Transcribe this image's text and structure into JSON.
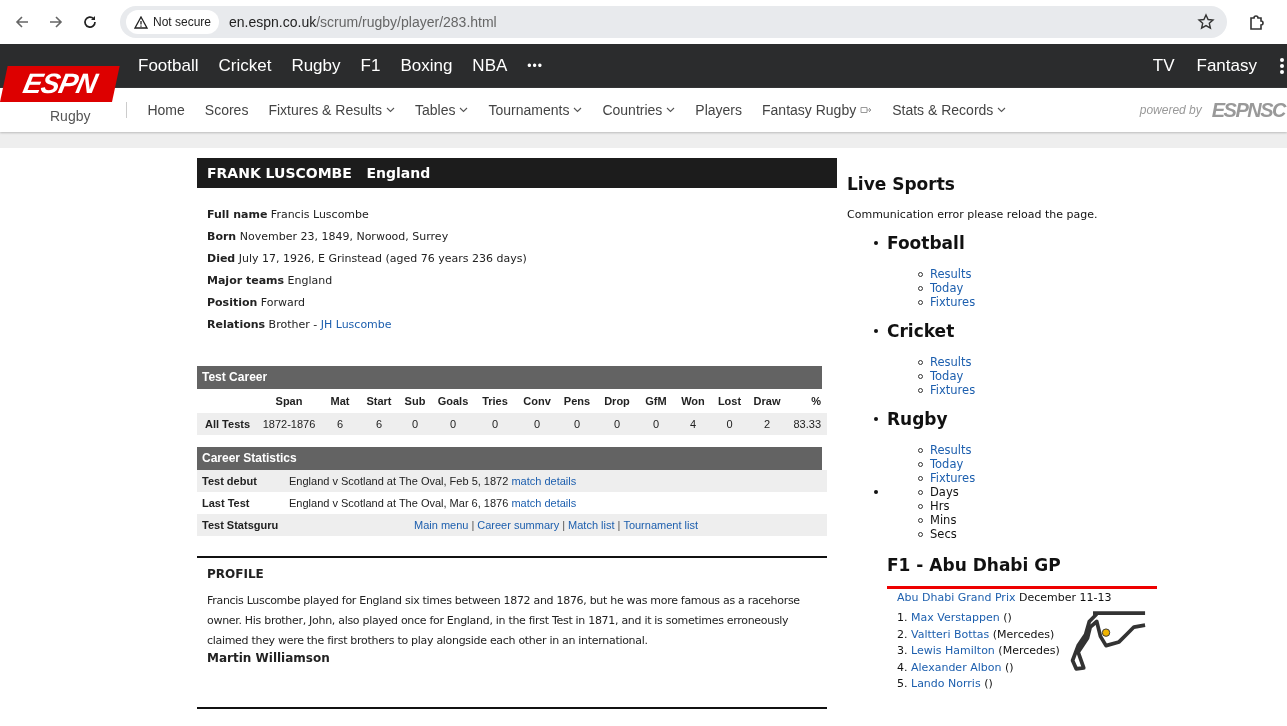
{
  "browser": {
    "security": "Not secure",
    "url_host": "en.espn.co.uk",
    "url_path": "/scrum/rugby/player/283.html"
  },
  "espn_nav": {
    "logo": "ESPN",
    "sports": [
      "Football",
      "Cricket",
      "Rugby",
      "F1",
      "Boxing",
      "NBA"
    ],
    "more": "•••",
    "right": [
      "TV",
      "Fantasy"
    ]
  },
  "sub_nav": {
    "section": "Rugby",
    "items": [
      {
        "label": "Home",
        "dropdown": false,
        "external": false
      },
      {
        "label": "Scores",
        "dropdown": false,
        "external": false
      },
      {
        "label": "Fixtures & Results",
        "dropdown": true,
        "external": false
      },
      {
        "label": "Tables",
        "dropdown": true,
        "external": false
      },
      {
        "label": "Tournaments",
        "dropdown": true,
        "external": false
      },
      {
        "label": "Countries",
        "dropdown": true,
        "external": false
      },
      {
        "label": "Players",
        "dropdown": false,
        "external": false
      },
      {
        "label": "Fantasy Rugby",
        "dropdown": false,
        "external": true
      },
      {
        "label": "Stats & Records",
        "dropdown": true,
        "external": false
      }
    ],
    "powered_by": "powered by",
    "brand": "ESPNSC"
  },
  "player": {
    "name": "FRANK LUSCOMBE",
    "country": "England",
    "info": [
      {
        "label": "Full name",
        "value": "Francis Luscombe"
      },
      {
        "label": "Born",
        "value": "November 23, 1849, Norwood, Surrey"
      },
      {
        "label": "Died",
        "value": "July 17, 1926, E Grinstead (aged 76 years 236 days)"
      },
      {
        "label": "Major teams",
        "value": "England"
      },
      {
        "label": "Position",
        "value": "Forward"
      },
      {
        "label": "Relations",
        "value": "Brother - ",
        "link": "JH Luscombe"
      }
    ]
  },
  "test_career": {
    "title": "Test Career",
    "columns": [
      "Span",
      "Mat",
      "Start",
      "Sub",
      "Goals",
      "Tries",
      "Conv",
      "Pens",
      "Drop",
      "GfM",
      "Won",
      "Lost",
      "Draw",
      "%"
    ],
    "rows": [
      {
        "label": "All Tests",
        "cells": [
          "1872-1876",
          "6",
          "6",
          "0",
          "0",
          "0",
          "0",
          "0",
          "0",
          "0",
          "4",
          "0",
          "2",
          "83.33"
        ]
      }
    ]
  },
  "career_statistics": {
    "title": "Career Statistics",
    "rows": [
      {
        "label": "Test debut",
        "text": "England v Scotland at The Oval, Feb 5, 1872",
        "link": "match details"
      },
      {
        "label": "Last Test",
        "text": "England v Scotland at The Oval, Mar 6, 1876",
        "link": "match details"
      }
    ],
    "statsguru": {
      "label": "Test Statsguru",
      "separator": "|",
      "links": [
        "Main menu",
        "Career summary",
        "Match list",
        "Tournament list"
      ]
    }
  },
  "profile": {
    "heading": "PROFILE",
    "text": "Francis Luscombe played for England six times between 1872 and 1876, but he was more famous as a racehorse owner. His brother, John, also played once for England, in the first Test in 1871, and it is sometimes erroneously claimed they were the first brothers to play alongside each other in an international.",
    "author": "Martin Williamson"
  },
  "live_sports": {
    "title": "Live Sports",
    "message": "Communication error please reload the page.",
    "sections": [
      {
        "title": "Football",
        "links": [
          "Results",
          "Today",
          "Fixtures"
        ]
      },
      {
        "title": "Cricket",
        "links": [
          "Results",
          "Today",
          "Fixtures"
        ]
      },
      {
        "title": "Rugby",
        "links": [
          "Results",
          "Today",
          "Fixtures"
        ]
      }
    ],
    "countdown": [
      "Days",
      "Hrs",
      "Mins",
      "Secs"
    ],
    "f1": {
      "title": "F1 - Abu Dhabi GP",
      "event_link": "Abu Dhabi Grand Prix",
      "event_date": "December 11-13",
      "results": [
        {
          "rank": "1.",
          "driver": "Max Verstappen",
          "team": "()"
        },
        {
          "rank": "2.",
          "driver": "Valtteri Bottas",
          "team": "(Mercedes)"
        },
        {
          "rank": "3.",
          "driver": "Lewis Hamilton",
          "team": "(Mercedes)"
        },
        {
          "rank": "4.",
          "driver": "Alexander Albon",
          "team": "()"
        },
        {
          "rank": "5.",
          "driver": "Lando Norris",
          "team": "()"
        }
      ]
    }
  }
}
